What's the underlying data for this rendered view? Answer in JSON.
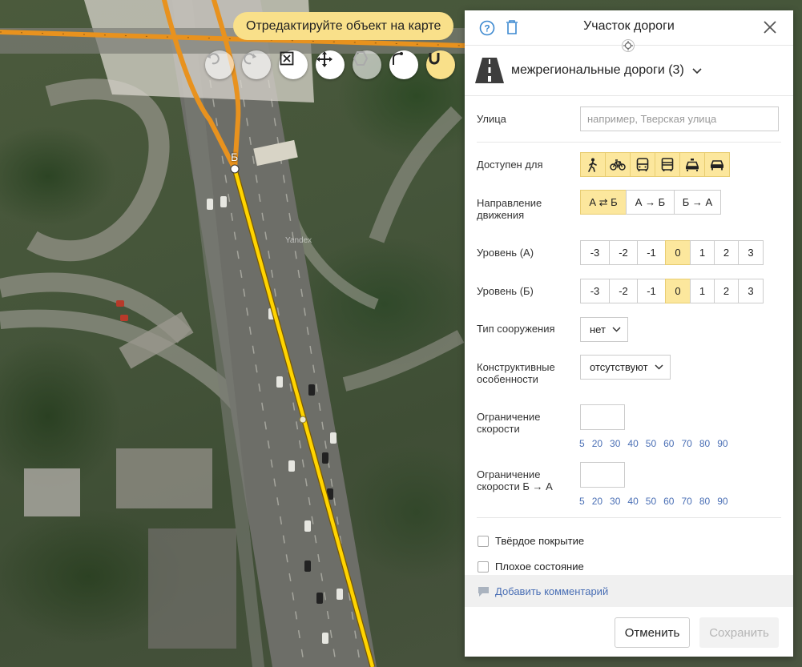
{
  "map": {
    "toast": "Отредактируйте объект на карте",
    "point_label": "Б",
    "watermark": "Yandex",
    "tools": [
      {
        "name": "undo-icon",
        "state": "disabled"
      },
      {
        "name": "redo-icon",
        "state": "disabled"
      },
      {
        "name": "fit-to-view-icon",
        "state": "normal"
      },
      {
        "name": "move-icon",
        "state": "normal"
      },
      {
        "name": "draw-polygon-icon",
        "state": "disabled"
      },
      {
        "name": "branch-icon",
        "state": "normal"
      },
      {
        "name": "magnet-snap-icon",
        "state": "active"
      }
    ]
  },
  "panel": {
    "title": "Участок дороги",
    "category": "межрегиональные дороги (3)",
    "street": {
      "label": "Улица",
      "placeholder": "например, Тверская улица"
    },
    "access": {
      "label": "Доступен для",
      "items": [
        "pedestrian-icon",
        "bicycle-icon",
        "bus-icon",
        "truck-icon",
        "taxi-icon",
        "car-icon"
      ]
    },
    "direction": {
      "label": "Направление движения",
      "options": [
        "А ⇄ Б",
        "А → Б",
        "Б → А"
      ],
      "selected": "А ⇄ Б"
    },
    "level_a": {
      "label": "Уровень (А)",
      "options": [
        "-3",
        "-2",
        "-1",
        "0",
        "1",
        "2",
        "3"
      ],
      "selected": "0"
    },
    "level_b": {
      "label": "Уровень (Б)",
      "options": [
        "-3",
        "-2",
        "-1",
        "0",
        "1",
        "2",
        "3"
      ],
      "selected": "0"
    },
    "structure": {
      "label": "Тип сооружения",
      "value": "нет"
    },
    "features": {
      "label": "Конструктивные особенности",
      "value": "отсутствуют"
    },
    "speed": {
      "label": "Ограничение скорости",
      "value": "",
      "presets": [
        "5",
        "20",
        "30",
        "40",
        "50",
        "60",
        "70",
        "80",
        "90"
      ]
    },
    "speed_ba": {
      "label": "Ограничение скорости Б → А",
      "value": "",
      "presets": [
        "5",
        "20",
        "30",
        "40",
        "50",
        "60",
        "70",
        "80",
        "90"
      ]
    },
    "checkboxes": [
      {
        "label": "Твёрдое покрытие",
        "checked": false
      },
      {
        "label": "Плохое состояние",
        "checked": false
      }
    ],
    "comment_link": "Добавить комментарий",
    "cancel": "Отменить",
    "save": "Сохранить"
  },
  "colors": {
    "accent_yellow": "#fce79d",
    "road_yellow": "#ffd400",
    "road_orange": "#e8921e",
    "link_blue": "#4a6fb5"
  }
}
